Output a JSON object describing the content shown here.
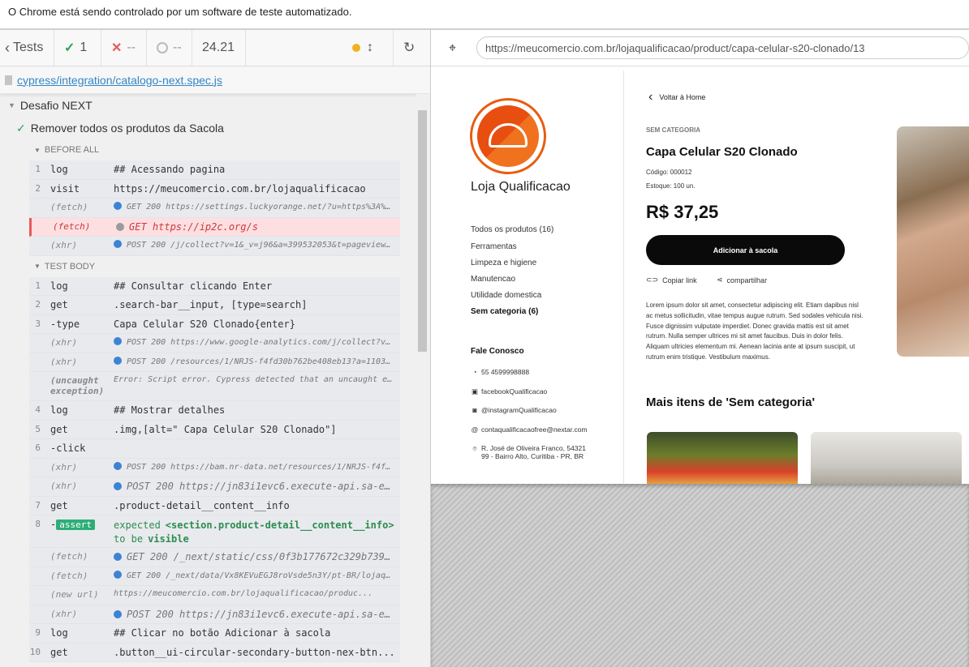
{
  "notice": "O Chrome está sendo controlado por um software de teste automatizado.",
  "runner": {
    "tests_label": "Tests",
    "passed": "1",
    "failed": "--",
    "pending": "--",
    "duration": "24.21",
    "spec_path": "cypress/integration/catalogo-next.spec.js",
    "suite": "Desafio NEXT",
    "test": "Remover todos os produtos da Sacola",
    "before_all": "BEFORE ALL",
    "test_body": "TEST BODY",
    "before_cmds": [
      {
        "num": "1",
        "name": "log",
        "msg": "## Acessando pagina"
      },
      {
        "num": "2",
        "name": "visit",
        "msg": "https://meucomercio.com.br/lojaqualificacao"
      },
      {
        "num": "",
        "name": "(fetch)",
        "msg": "GET 200 https://settings.luckyorange.net/?u=https%3A%2F%..."
      },
      {
        "num": "",
        "name": "(fetch)",
        "msg": "GET https://ip2c.org/s"
      },
      {
        "num": "",
        "name": "(xhr)",
        "msg": "POST 200 /j/collect?v=1&_v=j96&a=399532053&t=pageview&_s..."
      }
    ],
    "body_cmds": [
      {
        "num": "1",
        "name": "log",
        "msg": "## Consultar clicando Enter"
      },
      {
        "num": "2",
        "name": "get",
        "msg": ".search-bar__input, [type=search]"
      },
      {
        "num": "3",
        "name": "-type",
        "msg": "Capa Celular S20 Clonado{enter}"
      },
      {
        "num": "",
        "name": "(xhr)",
        "msg": "POST 200 https://www.google-analytics.com/j/collect?v=1&..."
      },
      {
        "num": "",
        "name": "(xhr)",
        "msg": "POST 200 /resources/1/NRJS-f4fd30b762be408eb13?a=1103090..."
      },
      {
        "num": "",
        "name": "(uncaught exception)",
        "msg": "Error: Script error. Cypress detected that an uncaught erro..."
      },
      {
        "num": "4",
        "name": "log",
        "msg": "## Mostrar detalhes"
      },
      {
        "num": "5",
        "name": "get",
        "msg": ".img,[alt=\" Capa Celular S20 Clonado\"]"
      },
      {
        "num": "6",
        "name": "-click",
        "msg": ""
      },
      {
        "num": "",
        "name": "(xhr)",
        "msg": "POST 200 https://bam.nr-data.net/resources/1/NRJS-f4fd30..."
      },
      {
        "num": "",
        "name": "(xhr)",
        "msg": "POST 200 https://jn83i1evc6.execute-api.sa-east..."
      },
      {
        "num": "7",
        "name": "get",
        "msg": ".product-detail__content__info"
      },
      {
        "num": "8",
        "name": "-assert",
        "msg1": "expected",
        "msg2": "<section.product-detail__content__info>",
        "msg3": "to be",
        "msg4": "visible"
      },
      {
        "num": "",
        "name": "(fetch)",
        "msg": "GET 200 /_next/static/css/0f3b177672c329b7394b..."
      },
      {
        "num": "",
        "name": "(fetch)",
        "msg": "GET 200 /_next/data/Vx8KEVuEGJ8roVsde5n3Y/pt-BR/lojaqual..."
      },
      {
        "num": "",
        "name": "(new url)",
        "msg": "https://meucomercio.com.br/lojaqualificacao/produc..."
      },
      {
        "num": "",
        "name": "(xhr)",
        "msg": "POST 200 https://jn83i1evc6.execute-api.sa-east..."
      },
      {
        "num": "9",
        "name": "log",
        "msg": "## Clicar no botão Adicionar à sacola"
      },
      {
        "num": "10",
        "name": "get",
        "msg": ".button__ui-circular-secondary-button-nex-btn..."
      }
    ]
  },
  "app": {
    "url": "https://meucomercio.com.br/lojaqualificacao/product/capa-celular-s20-clonado/13",
    "shop": "Loja Qualificacao",
    "categories": [
      "Todos os produtos (16)",
      "Ferramentas",
      "Limpeza e higiene",
      "Manutencao",
      "Utilidade domestica",
      "Sem categoria (6)"
    ],
    "fale": "Fale Conosco",
    "contacts": [
      "55 4599998888",
      "facebookQualificacao",
      "@instagramQualificacao",
      "contaqualificacaofree@nextar.com",
      "R. José de Oliveira Franco, 54321",
      "99 - Bairro Alto, Curitiba - PR, BR"
    ],
    "back": "Voltar à Home",
    "category": "SEM CATEGORIA",
    "product": "Capa Celular S20 Clonado",
    "code": "Código: 000012",
    "stock": "Estoque: 100 un.",
    "price": "R$ 37,25",
    "add_button": "Adicionar à sacola",
    "copy": "Copiar link",
    "share": "compartilhar",
    "description": "Lorem ipsum dolor sit amet, consectetur adipiscing elit. Etiam dapibus nisl ac metus sollicitudin, vitae tempus augue rutrum. Sed sodales vehicula nisi. Fusce dignissim vulputate imperdiet. Donec gravida mattis est sit amet rutrum. Nulla semper ultrices mi sit amet faucibus. Duis in dolor felis. Aliquam ultricies elementum mi. Aenean lacinia ante at ipsum suscipit, ut rutrum enim tristique. Vestibulum maximus.",
    "more": "Mais itens de 'Sem categoria'"
  },
  "colors": {
    "accent": "#e85d10",
    "pass": "#2a8d4f",
    "fail": "#e45b5b",
    "link": "#3386c6"
  }
}
